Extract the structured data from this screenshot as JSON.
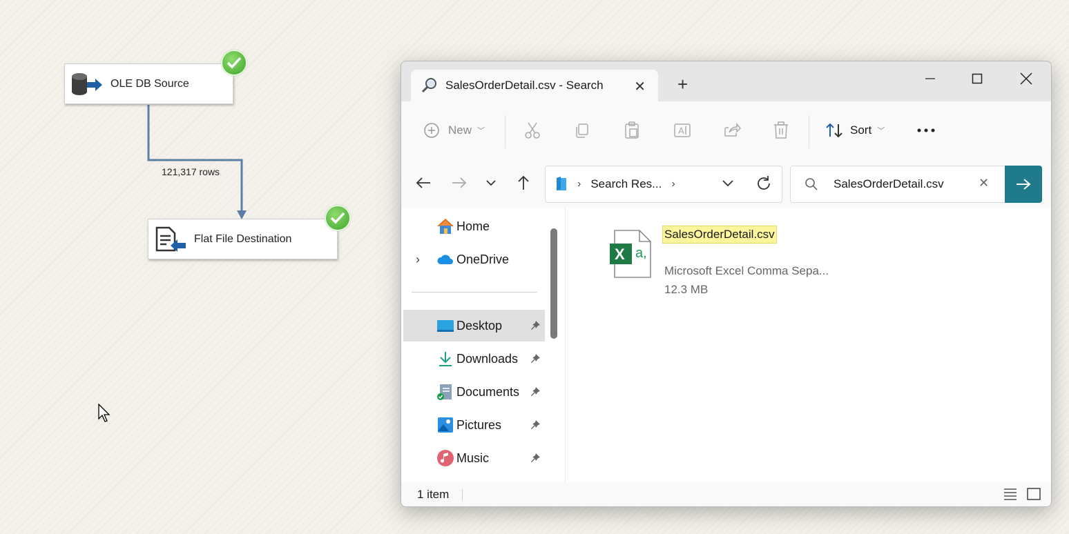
{
  "canvas": {
    "source_task": {
      "label": "OLE DB Source"
    },
    "destination_task": {
      "label": "Flat File Destination"
    },
    "path_label": "121,317 rows"
  },
  "explorer": {
    "tab_title": "SalesOrderDetail.csv - Search",
    "toolbar": {
      "new_label": "New",
      "sort_label": "Sort"
    },
    "address": {
      "crumb": "Search Res..."
    },
    "search": {
      "value": "SalesOrderDetail.csv"
    },
    "sidebar": {
      "items": [
        {
          "label": "Home"
        },
        {
          "label": "OneDrive"
        },
        {
          "label": "Desktop"
        },
        {
          "label": "Downloads"
        },
        {
          "label": "Documents"
        },
        {
          "label": "Pictures"
        },
        {
          "label": "Music"
        }
      ]
    },
    "results": [
      {
        "name": "SalesOrderDetail.csv",
        "type": "Microsoft Excel Comma Sepa...",
        "size": "12.3 MB"
      }
    ],
    "status": {
      "count": "1 item"
    },
    "colors": {
      "accent": "#1f7a8c",
      "highlight": "#fbf59b",
      "excel": "#1d7a45"
    }
  }
}
